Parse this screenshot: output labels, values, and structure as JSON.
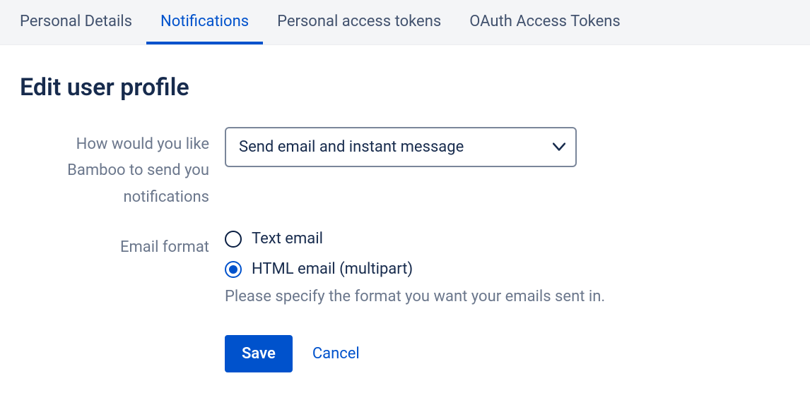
{
  "tabs": {
    "items": [
      {
        "label": "Personal Details",
        "active": false
      },
      {
        "label": "Notifications",
        "active": true
      },
      {
        "label": "Personal access tokens",
        "active": false
      },
      {
        "label": "OAuth Access Tokens",
        "active": false
      }
    ]
  },
  "page": {
    "title": "Edit user profile"
  },
  "form": {
    "notification_method": {
      "label": "How would you like Bamboo to send you notifications",
      "selected": "Send email and instant message"
    },
    "email_format": {
      "label": "Email format",
      "options": [
        {
          "label": "Text email",
          "checked": false
        },
        {
          "label": "HTML email (multipart)",
          "checked": true
        }
      ],
      "helper": "Please specify the format you want your emails sent in."
    },
    "buttons": {
      "save": "Save",
      "cancel": "Cancel"
    }
  }
}
